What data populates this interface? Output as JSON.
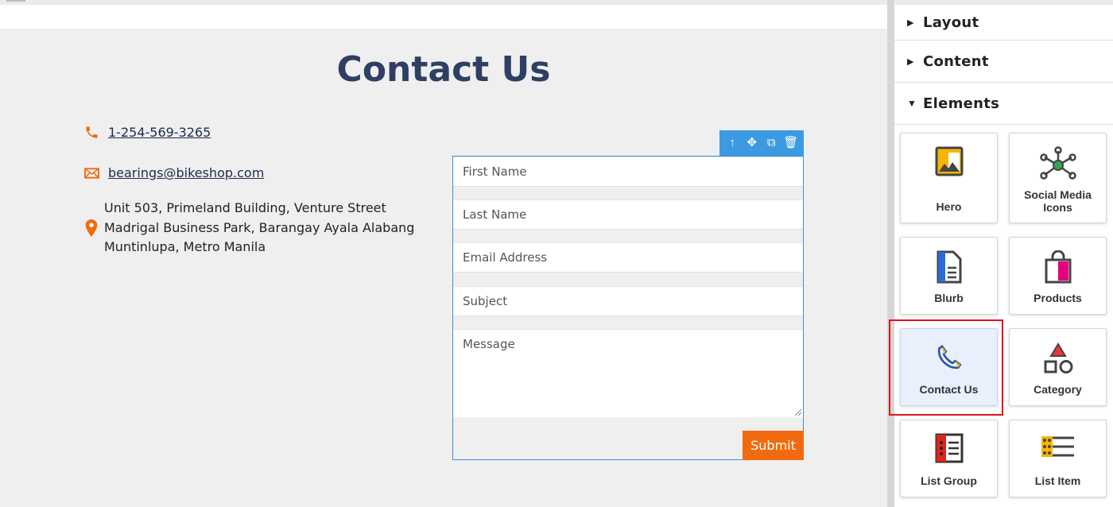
{
  "page": {
    "title": "Contact Us",
    "phone": "1-254-569-3265",
    "email": "bearings@bikeshop.com",
    "address_lines": [
      "Unit 503, Primeland Building, Venture Street",
      "Madrigal Business Park, Barangay Ayala Alabang",
      "Muntinlupa, Metro Manila"
    ]
  },
  "form": {
    "toolbar_icons": [
      "move-up-icon",
      "move-icon",
      "duplicate-icon",
      "delete-icon"
    ],
    "first_name_placeholder": "First Name",
    "last_name_placeholder": "Last Name",
    "email_placeholder": "Email Address",
    "subject_placeholder": "Subject",
    "message_placeholder": "Message",
    "submit_label": "Submit"
  },
  "panel": {
    "sections": [
      {
        "label": "Layout",
        "expanded": false
      },
      {
        "label": "Content",
        "expanded": false
      },
      {
        "label": "Elements",
        "expanded": true
      }
    ],
    "elements": [
      {
        "label": "Hero",
        "icon": "hero-image-icon"
      },
      {
        "label": "Social Media Icons",
        "label_lines": [
          "Social Media",
          "Icons"
        ],
        "icon": "social-network-icon"
      },
      {
        "label": "Blurb",
        "icon": "document-icon"
      },
      {
        "label": "Products",
        "icon": "shopping-bag-icon"
      },
      {
        "label": "Contact Us",
        "icon": "phone-icon",
        "selected": true
      },
      {
        "label": "Category",
        "icon": "shapes-icon"
      },
      {
        "label": "List Group",
        "icon": "list-group-icon"
      },
      {
        "label": "List Item",
        "icon": "list-item-icon"
      }
    ]
  },
  "colors": {
    "title": "#2f3f63",
    "accent_orange": "#f26a0f",
    "selection_blue": "#3b9ae1",
    "highlight_red": "#e1131b"
  }
}
